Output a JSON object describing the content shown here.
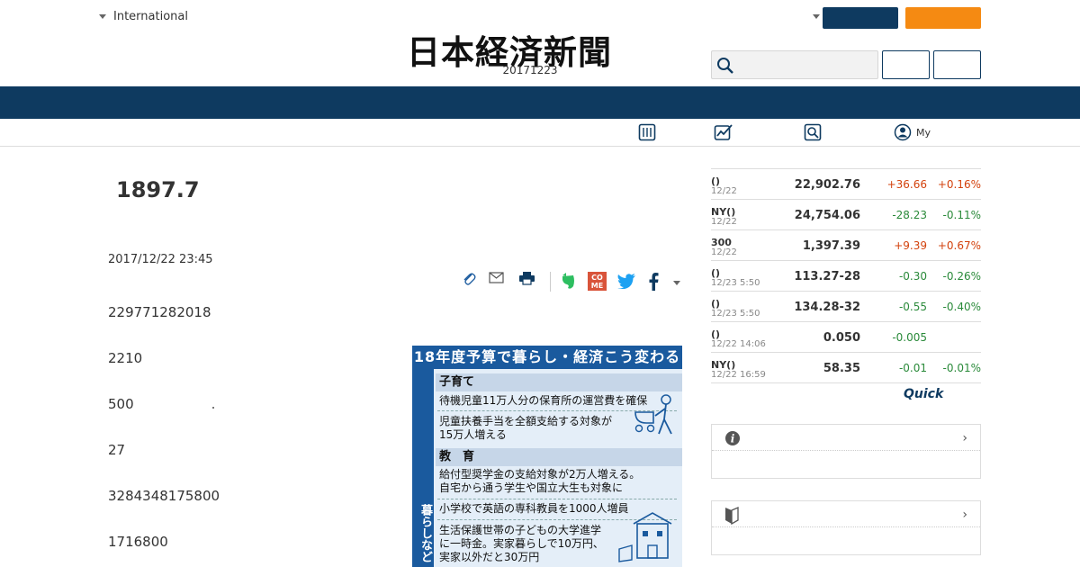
{
  "header": {
    "region_label": "International",
    "logo_text": "日本経済新聞",
    "date": "20171223",
    "login_label": "",
    "register_label": "",
    "search_placeholder": ""
  },
  "article": {
    "headline": "1897.7",
    "published": "2017/12/22 23:45",
    "paragraphs": [
      "229771282018",
      "2210",
      "500",
      "27",
      "3284348175800",
      "1716800"
    ]
  },
  "infographic": {
    "title": "18年度予算で暮らし・経済こう変わる",
    "side_label": "暮らしなど",
    "sections": [
      {
        "heading": "子育て",
        "items": [
          "待機児童11万人分の保育所の運営費を確保",
          "児童扶養手当を全額支給する対象が",
          "15万人増える"
        ]
      },
      {
        "heading": "教　育",
        "items": [
          "給付型奨学金の支給対象が2万人増える。",
          "自宅から通う学生や国立大生も対象に",
          "小学校で英語の専科教員を1000人増員",
          "生活保護世帯の子どもの大学進学",
          "に一時金。実家暮らしで10万円、",
          "実家以外だと30万円"
        ]
      }
    ]
  },
  "subnav": {
    "my_label": "My"
  },
  "market": {
    "rows": [
      {
        "name": "()",
        "time": "12/22",
        "price": "22,902.76",
        "change": "+36.66",
        "pct": "+0.16%",
        "dir": "up"
      },
      {
        "name": "NY()",
        "time": "12/22",
        "price": "24,754.06",
        "change": "-28.23",
        "pct": "-0.11%",
        "dir": "dn"
      },
      {
        "name": "300",
        "time": "12/22",
        "price": "1,397.39",
        "change": "+9.39",
        "pct": "+0.67%",
        "dir": "up"
      },
      {
        "name": "()",
        "time": "12/23 5:50",
        "price": "113.27-28",
        "change": "-0.30",
        "pct": "-0.26%",
        "dir": "dn"
      },
      {
        "name": "()",
        "time": "12/23 5:50",
        "price": "134.28-32",
        "change": "-0.55",
        "pct": "-0.40%",
        "dir": "dn"
      },
      {
        "name": "()",
        "time": "12/22 14:06",
        "price": "0.050",
        "change": "-0.005",
        "pct": "",
        "dir": "dn"
      },
      {
        "name": "NY()",
        "time": "12/22 16:59",
        "price": "58.35",
        "change": "-0.01",
        "pct": "-0.01%",
        "dir": "dn"
      }
    ],
    "quick_label": "Quick"
  },
  "colors": {
    "navy": "#0e3a60",
    "orange": "#f58a12",
    "up": "#d3420d",
    "down": "#2a8a3a"
  }
}
